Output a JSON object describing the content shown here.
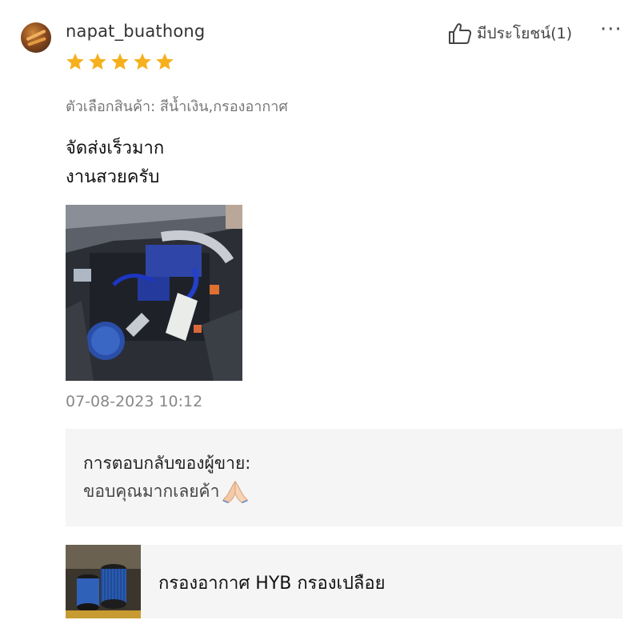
{
  "review": {
    "username": "napat_buathong",
    "helpful_label": "มีประโยชน์(1)",
    "more_label": "···",
    "rating": 5,
    "rating_max": 5,
    "star_color": "#f6b01e",
    "variation": "ตัวเลือกสินค้า: สีน้ำเงิน,กรองอากาศ",
    "comment_lines": [
      "จัดส่งเร็วมาก",
      "งานสวยครับ"
    ],
    "timestamp": "07-08-2023 10:12"
  },
  "seller_reply": {
    "title": "การตอบกลับของผู้ขาย:",
    "text": "ขอบคุณมากเลยค้า"
  },
  "product": {
    "name": "กรองอากาศ HYB กรองเปลือย"
  }
}
